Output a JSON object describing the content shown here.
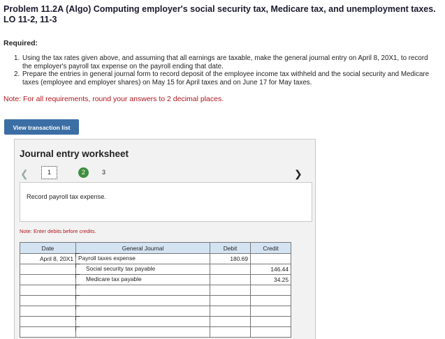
{
  "title": "Problem 11.2A (Algo) Computing employer's social security tax, Medicare tax, and unemployment taxes. LO 11-2, 11-3",
  "required_label": "Required:",
  "requirements": [
    {
      "num": "1.",
      "text": "Using the tax rates given above, and assuming that all earnings are taxable, make the general journal entry on April 8, 20X1, to record the employer's payroll tax expense on the payroll ending that date."
    },
    {
      "num": "2.",
      "text": "Prepare the entries in general journal form to record deposit of the employee income tax withheld and the social security and Medicare taxes (employee and employer shares) on May 15 for April taxes and on June 17 for May taxes."
    }
  ],
  "note_main": "Note: For all requirements, round your answers to 2 decimal places.",
  "view_button": "View transaction list",
  "worksheet": {
    "title": "Journal entry worksheet",
    "prev_icon": "chevron-left-icon",
    "next_icon": "chevron-right-icon",
    "tabs": [
      "1",
      "2",
      "3"
    ],
    "instruction": "Record payroll tax expense.",
    "note_enter": "Note: Enter debits before credits."
  },
  "journal": {
    "headers": {
      "date": "Date",
      "general_journal": "General Journal",
      "debit": "Debit",
      "credit": "Credit"
    },
    "rows": [
      {
        "date": "April 8, 20X1",
        "account": "Payroll taxes expense",
        "debit": "180.69",
        "credit": "",
        "type": "debit"
      },
      {
        "date": "",
        "account": "Social security tax payable",
        "debit": "",
        "credit": "146.44",
        "type": "credit"
      },
      {
        "date": "",
        "account": "Medicare tax payable",
        "debit": "",
        "credit": "34.25",
        "type": "credit"
      },
      {
        "date": "",
        "account": "",
        "debit": "",
        "credit": "",
        "type": "debit"
      },
      {
        "date": "",
        "account": "",
        "debit": "",
        "credit": "",
        "type": "debit"
      },
      {
        "date": "",
        "account": "",
        "debit": "",
        "credit": "",
        "type": "debit"
      },
      {
        "date": "",
        "account": "",
        "debit": "",
        "credit": "",
        "type": "debit"
      },
      {
        "date": "",
        "account": "",
        "debit": "",
        "credit": "",
        "type": "debit"
      }
    ]
  }
}
